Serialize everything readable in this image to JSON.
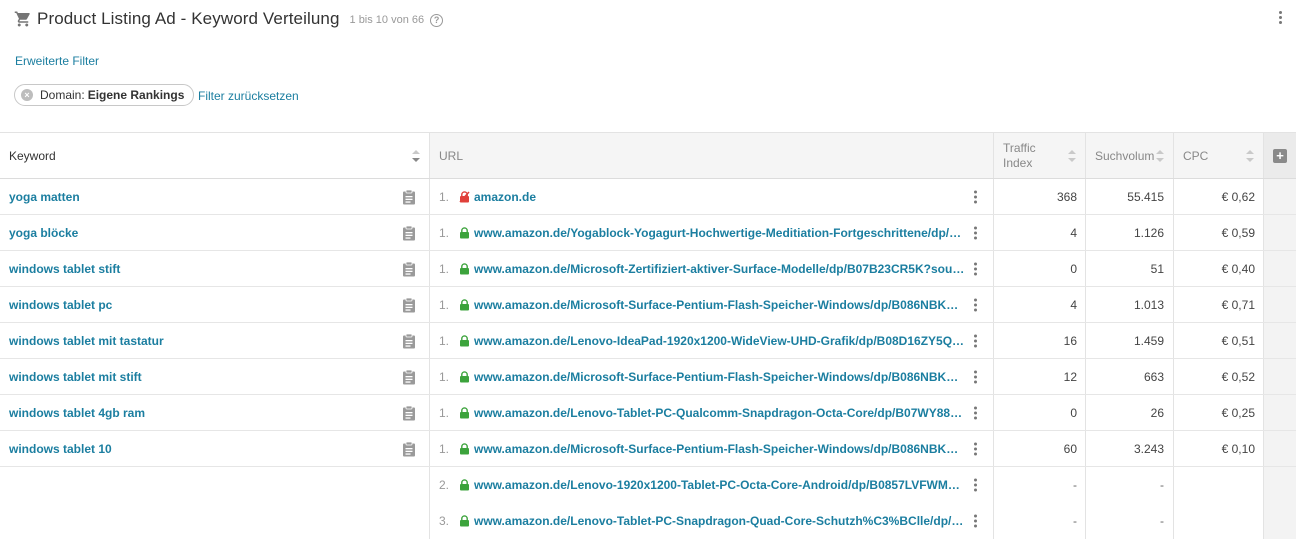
{
  "header": {
    "title": "Product Listing Ad - Keyword Verteilung",
    "count": "1 bis 10 von 66",
    "help": "?"
  },
  "filters": {
    "advanced": "Erweiterte Filter",
    "chip_label": "Domain:",
    "chip_value": "Eigene Rankings",
    "reset": "Filter zurücksetzen"
  },
  "columns": {
    "keyword": "Keyword",
    "url": "URL",
    "traffic_1": "Traffic",
    "traffic_2": "Index",
    "volume": "Suchvolum",
    "cpc": "CPC"
  },
  "rows": [
    {
      "keyword": "yoga matten",
      "rank": "1.",
      "secure": false,
      "url": "amazon.de",
      "traffic": "368",
      "volume": "55.415",
      "cpc": "€ 0,62"
    },
    {
      "keyword": "yoga blöcke",
      "rank": "1.",
      "secure": true,
      "url": "www.amazon.de/Yogablock-Yogagurt-Hochwertige-Meditiation-Fortgeschrittene/dp/B088...",
      "traffic": "4",
      "volume": "1.126",
      "cpc": "€ 0,59"
    },
    {
      "keyword": "windows tablet stift",
      "rank": "1.",
      "secure": true,
      "url": "www.amazon.de/Microsoft-Zertifiziert-aktiver-Surface-Modelle/dp/B07B23CR5K?source=p...",
      "traffic": "0",
      "volume": "51",
      "cpc": "€ 0,40"
    },
    {
      "keyword": "windows tablet pc",
      "rank": "1.",
      "secure": true,
      "url": "www.amazon.de/Microsoft-Surface-Pentium-Flash-Speicher-Windows/dp/B086NBKQMR?s...",
      "traffic": "4",
      "volume": "1.013",
      "cpc": "€ 0,71"
    },
    {
      "keyword": "windows tablet mit tastatur",
      "rank": "1.",
      "secure": true,
      "url": "www.amazon.de/Lenovo-IdeaPad-1920x1200-WideView-UHD-Grafik/dp/B08D16ZY5Q?sour...",
      "traffic": "16",
      "volume": "1.459",
      "cpc": "€ 0,51"
    },
    {
      "keyword": "windows tablet mit stift",
      "rank": "1.",
      "secure": true,
      "url": "www.amazon.de/Microsoft-Surface-Pentium-Flash-Speicher-Windows/dp/B086NBKQMR?s...",
      "traffic": "12",
      "volume": "663",
      "cpc": "€ 0,52"
    },
    {
      "keyword": "windows tablet 4gb ram",
      "rank": "1.",
      "secure": true,
      "url": "www.amazon.de/Lenovo-Tablet-PC-Qualcomm-Snapdragon-Octa-Core/dp/B07WY88LT3?s...",
      "traffic": "0",
      "volume": "26",
      "cpc": "€ 0,25"
    },
    {
      "keyword": "windows tablet 10",
      "rank": "1.",
      "secure": true,
      "url": "www.amazon.de/Microsoft-Surface-Pentium-Flash-Speicher-Windows/dp/B086NBKQMR?s...",
      "traffic": "60",
      "volume": "3.243",
      "cpc": "€ 0,10"
    }
  ],
  "subrows": [
    {
      "rank": "2.",
      "secure": true,
      "url": "www.amazon.de/Lenovo-1920x1200-Tablet-PC-Octa-Core-Android/dp/B0857LVFWM?sour...",
      "traffic": "-",
      "volume": "-"
    },
    {
      "rank": "3.",
      "secure": true,
      "url": "www.amazon.de/Lenovo-Tablet-PC-Snapdragon-Quad-Core-Schutzh%C3%BClle/dp/B07SQ...",
      "traffic": "-",
      "volume": "-"
    }
  ],
  "colors": {
    "link": "#1b7ea0",
    "secure": "#3ca33c",
    "insecure": "#e0403a"
  }
}
